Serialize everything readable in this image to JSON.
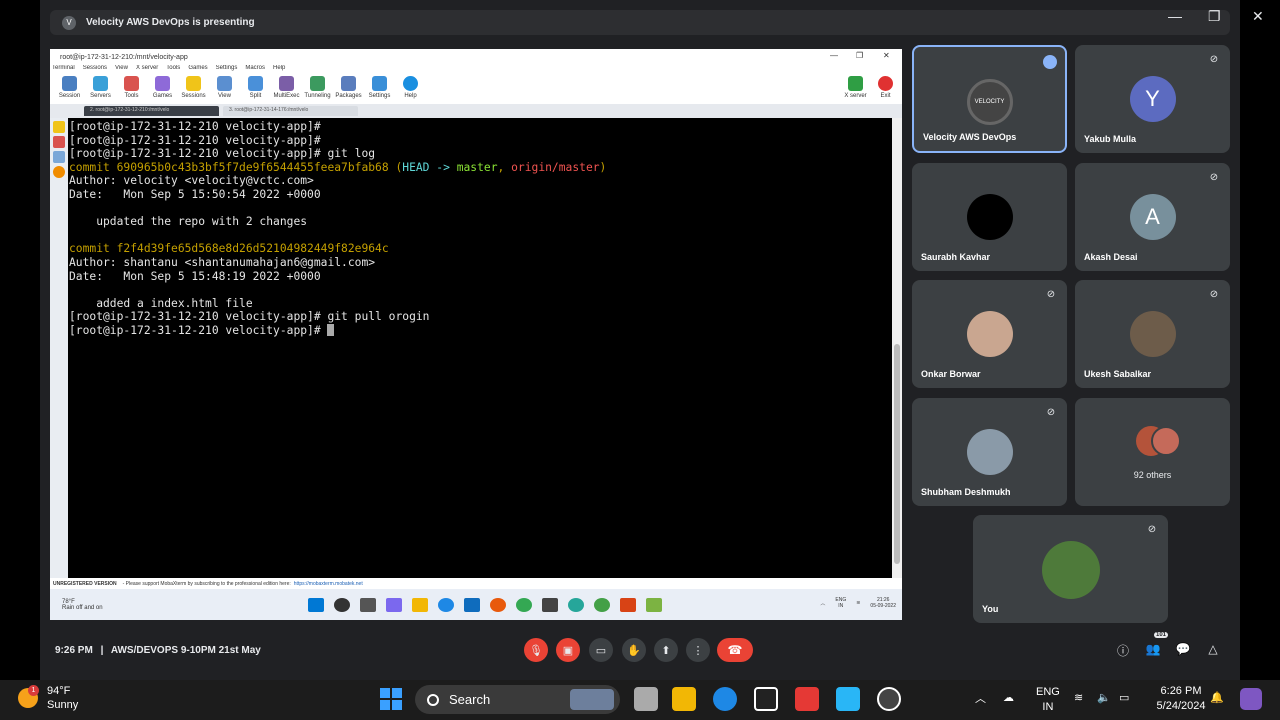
{
  "banner": {
    "text": "Velocity AWS DevOps is presenting"
  },
  "moba": {
    "title": "root@ip-172-31-12-210:/mnt/velocity-app",
    "menu": [
      "Terminal",
      "Sessions",
      "View",
      "X server",
      "Tools",
      "Games",
      "Settings",
      "Macros",
      "Help"
    ],
    "toolbar": [
      "Session",
      "Servers",
      "Tools",
      "Games",
      "Sessions",
      "View",
      "Split",
      "MultiExec",
      "Tunneling",
      "Packages",
      "Settings",
      "Help"
    ],
    "toolbar_right": [
      "X server",
      "Exit"
    ],
    "tabs": [
      "2. root@ip-172-31-12-210:/mnt/velo",
      "3. root@ip-172-31-14-176:/mnt/velo"
    ],
    "terminal": {
      "l1": "[root@ip-172-31-12-210 velocity-app]#",
      "l2": "[root@ip-172-31-12-210 velocity-app]#",
      "l3": "[root@ip-172-31-12-210 velocity-app]# git log",
      "c1_hash": "commit 690965b0c43b3bf5f7de9f6544455feea7bfab68",
      "c1_open": " (",
      "c1_head": "HEAD -> ",
      "c1_master": "master",
      "c1_comma": ", ",
      "c1_origin": "origin/master",
      "c1_close": ")",
      "c1_author": "Author: velocity <velocity@vctc.com>",
      "c1_date": "Date:   Mon Sep 5 15:50:54 2022 +0000",
      "c1_msg": "    updated the repo with 2 changes",
      "c2_hash": "commit f2f4d39fe65d568e8d26d52104982449f82e964c",
      "c2_author": "Author: shantanu <shantanumahajan6@gmail.com>",
      "c2_date": "Date:   Mon Sep 5 15:48:19 2022 +0000",
      "c2_msg": "    added a index.html file",
      "l4": "[root@ip-172-31-12-210 velocity-app]# git pull orogin",
      "l5": "[root@ip-172-31-12-210 velocity-app]# "
    },
    "unregistered": "UNREGISTERED VERSION",
    "unregistered_msg": "-  Please support MobaXterm by subscribing to the professional edition here:",
    "unregistered_link": "https://mobaxterm.mobatek.net",
    "inner_weather_temp": "78°F",
    "inner_weather_desc": "Rain off and on",
    "inner_lang": "ENG",
    "inner_region": "IN",
    "inner_time": "21:26",
    "inner_date": "05-09-2022"
  },
  "participants": [
    {
      "name": "Velocity AWS DevOps",
      "initial": "VELOCITY",
      "color": "#444"
    },
    {
      "name": "Yakub Mulla",
      "initial": "Y",
      "color": "#5c6bc0"
    },
    {
      "name": "Saurabh Kavhar",
      "initial": "",
      "color": "#000"
    },
    {
      "name": "Akash Desai",
      "initial": "A",
      "color": "#78909c"
    },
    {
      "name": "Onkar Borwar",
      "initial": "",
      "color": "#c9a690"
    },
    {
      "name": "Ukesh Sabalkar",
      "initial": "",
      "color": "#6d5c4a"
    },
    {
      "name": "Shubham Deshmukh",
      "initial": "",
      "color": "#8a9aa8"
    },
    {
      "name": "92 others",
      "initial": "",
      "color": "#b4533a"
    },
    {
      "name": "You",
      "initial": "",
      "color": "#4e7a3a"
    }
  ],
  "meeting": {
    "time": "9:26 PM",
    "separator": "|",
    "title": "AWS/DEVOPS 9-10PM 21st May",
    "people_count": "101"
  },
  "taskbar": {
    "temp": "94°F",
    "weather": "Sunny",
    "weather_badge": "1",
    "search": "Search",
    "lang": "ENG",
    "region": "IN",
    "time": "6:26 PM",
    "date": "5/24/2024"
  },
  "colors": {
    "accent": "#8ab4f8",
    "danger": "#ea4335",
    "bg": "#202124",
    "tile": "#3c4043"
  }
}
